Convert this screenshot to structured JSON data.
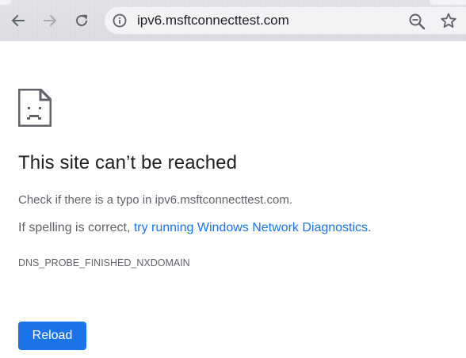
{
  "browser": {
    "url": "ipv6.msftconnecttest.com",
    "icons": {
      "back": "arrow-left-icon",
      "forward": "arrow-right-icon",
      "reload": "reload-icon",
      "site_info": "info-icon",
      "zoom": "zoom-out-icon",
      "bookmark": "star-icon"
    }
  },
  "error_page": {
    "icon": "sad-page-icon",
    "title": "This site can’t be reached",
    "check_typo": "Check if there is a typo in ipv6.msftconnecttest.com.",
    "spelling_prefix": "If spelling is correct, ",
    "diagnostics_link": "try running Windows Network Diagnostics",
    "spelling_suffix": ".",
    "error_code": "DNS_PROBE_FINISHED_NXDOMAIN",
    "reload_label": "Reload"
  },
  "colors": {
    "link": "#1a73e8",
    "button_bg": "#1a73e8",
    "toolbar_bg": "#dee1e6",
    "omnibox_bg": "#f1f3f4"
  }
}
